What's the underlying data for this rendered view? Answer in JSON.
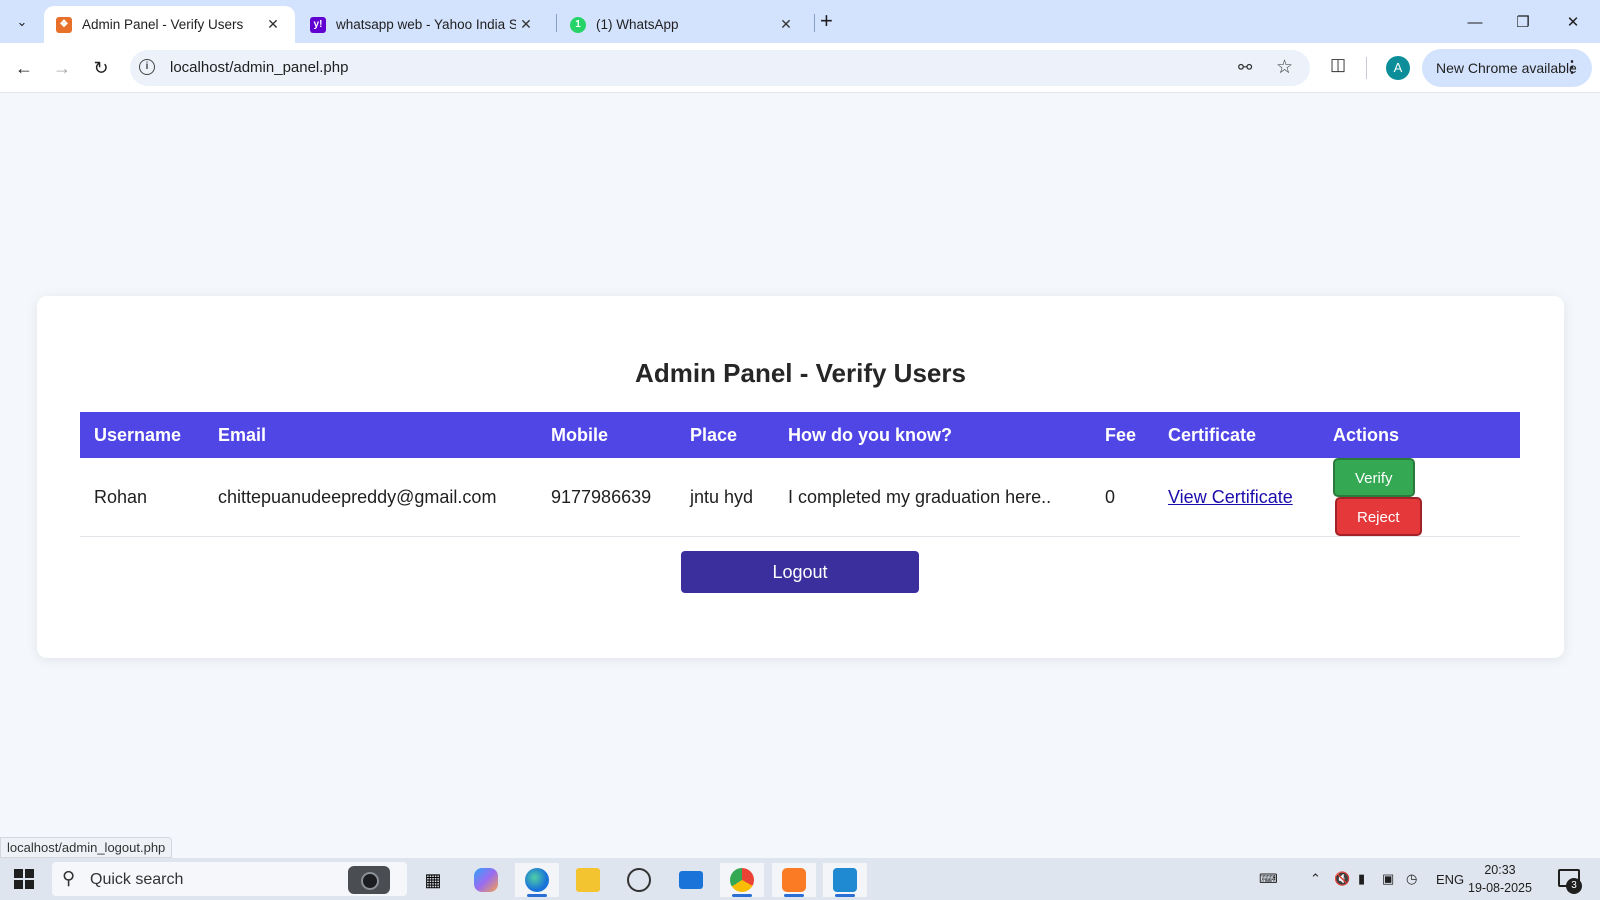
{
  "browser": {
    "tabs": [
      {
        "title": "Admin Panel - Verify Users",
        "favicon_color": "#e8702a",
        "active": true
      },
      {
        "title": "whatsapp web - Yahoo India Se",
        "favicon_color": "#6001d2",
        "active": false
      },
      {
        "title": "(1) WhatsApp",
        "favicon_color": "#25d366",
        "active": false
      }
    ],
    "tab_search_icon": "chevron-down-icon",
    "new_tab_label": "+",
    "url": "localhost/admin_panel.php",
    "profile_initial": "A",
    "update_label": "New Chrome available",
    "status_url": "localhost/admin_logout.php"
  },
  "page": {
    "title": "Admin Panel - Verify Users",
    "columns": [
      "Username",
      "Email",
      "Mobile",
      "Place",
      "How do you know?",
      "Fee",
      "Certificate",
      "Actions"
    ],
    "rows": [
      {
        "username": "Rohan",
        "email": "chittepuanudeepreddy@gmail.com",
        "mobile": "9177986639",
        "place": "jntu hyd",
        "how": "I completed my graduation here..",
        "fee": "0",
        "certificate_label": "View Certificate",
        "verify_label": "Verify",
        "reject_label": "Reject"
      }
    ],
    "logout_label": "Logout",
    "colors": {
      "header": "#4f46e5",
      "verify": "#34a853",
      "reject": "#e5383b",
      "logout": "#3b2f9e"
    }
  },
  "taskbar": {
    "search_placeholder": "Quick search",
    "language": "ENG",
    "time": "20:33",
    "date": "19-08-2025",
    "notification_count": "3"
  }
}
